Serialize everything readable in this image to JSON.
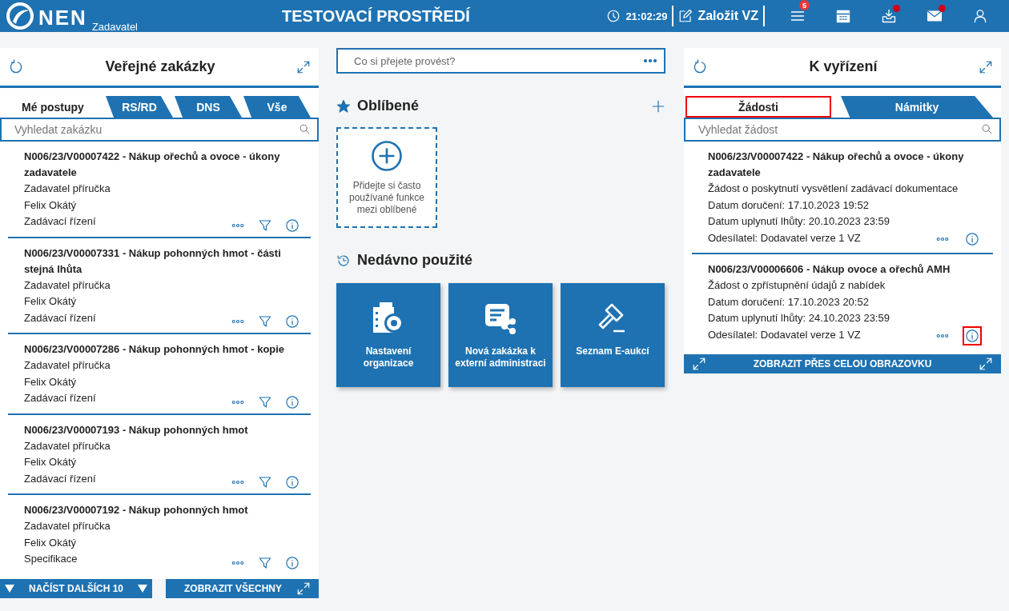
{
  "header": {
    "logo": "NEN",
    "role": "Zadavatel",
    "title": "TESTOVACÍ PROSTŘEDÍ",
    "time": "21:02:29",
    "create_button": "Založit VZ",
    "icons": [
      {
        "kind": "menu",
        "badge": "5",
        "notification": false
      },
      {
        "kind": "calendar",
        "notification": false
      },
      {
        "kind": "inbox",
        "notification": true
      },
      {
        "kind": "mail",
        "notification": true
      },
      {
        "kind": "user",
        "notification": false
      }
    ]
  },
  "left_panel": {
    "title": "Veřejné zakázky",
    "tabs": [
      {
        "label": "Mé postupy",
        "selected": true
      },
      {
        "label": "RS/RD",
        "selected": false
      },
      {
        "label": "DNS",
        "selected": false
      },
      {
        "label": "Vše",
        "selected": false
      }
    ],
    "search": {
      "placeholder": "Vyhledat zakázku"
    },
    "items": [
      {
        "title": "N006/23/V00007422 - Nákup ořechů a ovoce - úkony zadavatele",
        "lines": [
          "Zadavatel příručka",
          "Felix Okátý",
          "Zadávací řízení"
        ]
      },
      {
        "title": "N006/23/V00007331 - Nákup pohonných hmot - části stejná lhůta",
        "lines": [
          "Zadavatel příručka",
          "Felix Okátý",
          "Zadávací řízení"
        ]
      },
      {
        "title": "N006/23/V00007286 - Nákup pohonných hmot - kopie",
        "lines": [
          "Zadavatel příručka",
          "Felix Okátý",
          "Zadávací řízení"
        ]
      },
      {
        "title": "N006/23/V00007193 - Nákup pohonných hmot",
        "lines": [
          "Zadavatel příručka",
          "Felix Okátý",
          "Zadávací řízení"
        ]
      },
      {
        "title": "N006/23/V00007192 - Nákup pohonných hmot",
        "lines": [
          "Zadavatel příručka",
          "Felix Okátý",
          "Specifikace"
        ]
      }
    ],
    "load_more_button": "NAČÍST DALŠÍCH 10",
    "show_all_button": "ZOBRAZIT VŠECHNY"
  },
  "center": {
    "command_field": {
      "placeholder": "Co si přejete provést?"
    },
    "favorites": {
      "title": "Oblíbené",
      "empty_text": "Přidejte si často používané funkce mezi oblíbené"
    },
    "recent": {
      "title": "Nedávno použité",
      "tiles": [
        {
          "kind": "org-settings",
          "label": "Nastavení organizace"
        },
        {
          "kind": "share-document",
          "label": "Nová zakázka k externí administraci"
        },
        {
          "kind": "gavel",
          "label": "Seznam E-aukcí"
        }
      ]
    }
  },
  "right_panel": {
    "title": "K vyřízení",
    "tabs": [
      {
        "label": "Žádosti",
        "selected": true,
        "highlighted": true
      },
      {
        "label": "Námitky",
        "selected": false,
        "highlighted": false
      }
    ],
    "search": {
      "placeholder": "Vyhledat žádost"
    },
    "items": [
      {
        "title": "N006/23/V00007422 - Nákup ořechů a ovoce - úkony zadavatele",
        "lines": [
          "Žádost o poskytnutí vysvětlení zadávací dokumentace",
          "Datum doručení: 17.10.2023 19:52",
          "Datum uplynutí lhůty: 20.10.2023 23:59",
          "Odesílatel: Dodavatel verze 1 VZ"
        ],
        "info_highlighted": false
      },
      {
        "title": "N006/23/V00006606 - Nákup ovoce a ořechů AMH",
        "lines": [
          "Žádost o zpřístupnění údajů z nabídek",
          "Datum doručení: 17.10.2023 20:52",
          "Datum uplynutí lhůty: 24.10.2023 23:59",
          "Odesílatel: Dodavatel verze 1 VZ"
        ],
        "info_highlighted": true
      }
    ],
    "fullscreen_button": "ZOBRAZIT PŘES CELOU OBRAZOVKU"
  }
}
